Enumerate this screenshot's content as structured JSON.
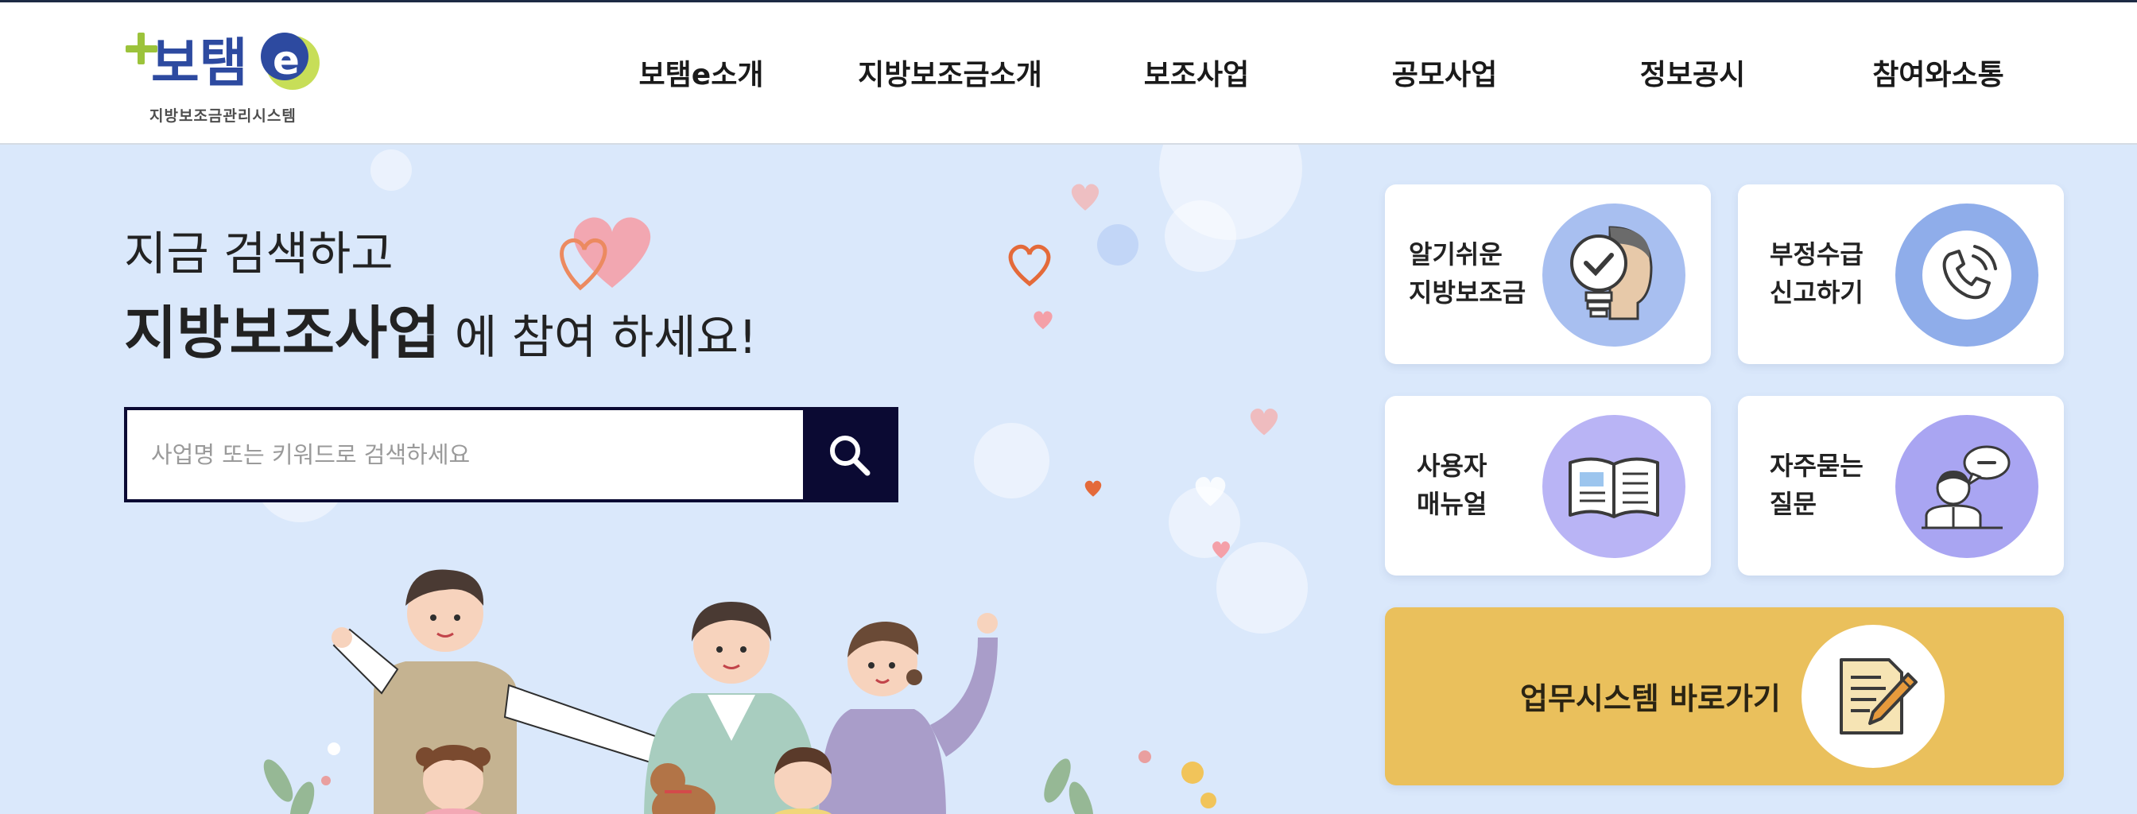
{
  "header": {
    "logo_subtitle": "지방보조금관리시스템",
    "nav": [
      {
        "label": "보탬e소개"
      },
      {
        "label": "지방보조금소개"
      },
      {
        "label": "보조사업"
      },
      {
        "label": "공모사업"
      },
      {
        "label": "정보공시"
      },
      {
        "label": "참여와소통"
      }
    ]
  },
  "hero": {
    "line1": "지금 검색하고",
    "line2_bold": "지방보조사업",
    "line2_rest": " 에 참여 하세요!"
  },
  "search": {
    "placeholder": "사업명 또는 키워드로 검색하세요",
    "value": ""
  },
  "cards": [
    {
      "line1": "알기쉬운",
      "line2": "지방보조금",
      "icon": "lightbulb-head-icon",
      "color": "#a8bff0"
    },
    {
      "line1": "부정수급",
      "line2": "신고하기",
      "icon": "phone-icon",
      "color": "#8fadea"
    },
    {
      "line1": "사용자",
      "line2": "매뉴얼",
      "icon": "book-icon",
      "color": "#b9b4f5"
    },
    {
      "line1": "자주묻는",
      "line2": "질문",
      "icon": "chat-person-icon",
      "color": "#a9a5f2"
    }
  ],
  "work_system": {
    "label": "업무시스템 바로가기",
    "icon": "document-pencil-icon",
    "color": "#eac05c"
  }
}
